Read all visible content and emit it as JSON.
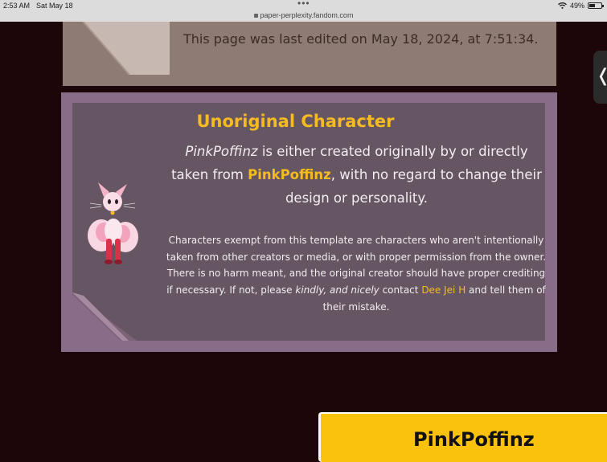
{
  "status_bar": {
    "time": "2:53 AM",
    "date": "Sat May 18",
    "url": "paper-perplexity.fandom.com",
    "battery": "49%"
  },
  "last_edited": "This page was last edited on May 18, 2024, at 7:51:34.",
  "template": {
    "title": "Unoriginal Character",
    "main_subject": "PinkPoffinz",
    "main_part1": " is either created originally by or directly taken from ",
    "main_source": "PinkPoffinz",
    "main_part2": ", with no regard to change their design or personality.",
    "note_part1": "Characters exempt from this template are characters who aren't intentionally taken from other creators or media, or with proper permission from the owner. There is no harm meant, and the original creator should have proper crediting if necessary. If not, please ",
    "note_emphasis": "kindly, and nicely",
    "note_part2": " contact ",
    "note_link": "Dee Jei H",
    "note_part3": " and tell them of their mistake."
  },
  "infobox_title": "PinkPoffinz",
  "colors": {
    "accent": "#f6bb23",
    "template_outer": "#896c87",
    "template_inner": "#665563",
    "page_background": "#1c0609"
  },
  "icons": [
    "wifi-icon",
    "battery-icon",
    "lock-icon",
    "chevron-left-icon"
  ]
}
